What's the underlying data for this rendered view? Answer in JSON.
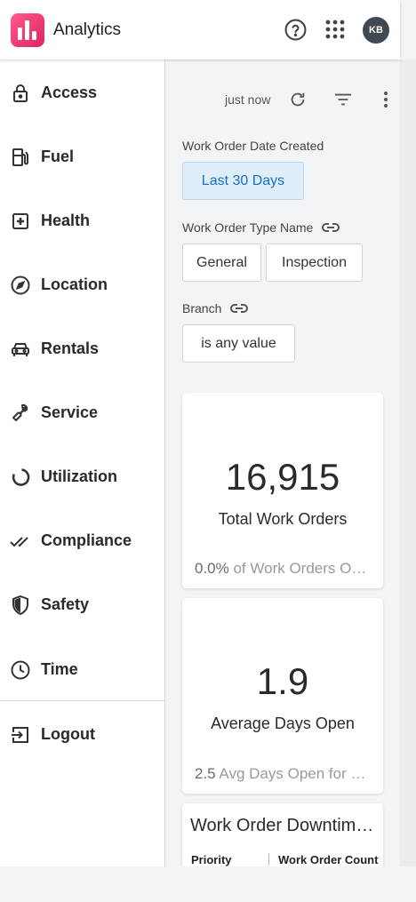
{
  "header": {
    "app_title": "Analytics",
    "help_icon": "help-circle-icon",
    "apps_icon": "apps-grid-icon",
    "avatar_initials": "KB"
  },
  "sidebar": {
    "items": [
      {
        "label": "Access",
        "icon": "lock-icon"
      },
      {
        "label": "Fuel",
        "icon": "fuel-pump-icon"
      },
      {
        "label": "Health",
        "icon": "medical-plus-icon"
      },
      {
        "label": "Location",
        "icon": "compass-icon"
      },
      {
        "label": "Rentals",
        "icon": "car-icon"
      },
      {
        "label": "Service",
        "icon": "wrench-icon"
      },
      {
        "label": "Utilization",
        "icon": "donut-icon"
      },
      {
        "label": "Compliance",
        "icon": "double-check-icon"
      },
      {
        "label": "Safety",
        "icon": "shield-icon"
      },
      {
        "label": "Time",
        "icon": "clock-icon"
      }
    ],
    "logout": {
      "label": "Logout",
      "icon": "logout-icon"
    }
  },
  "toolbar": {
    "updated_text": "just now",
    "refresh_icon": "refresh-icon",
    "filter_icon": "filter-icon",
    "more_icon": "more-vertical-icon"
  },
  "filters": {
    "date": {
      "label": "Work Order Date Created",
      "value": "Last 30 Days"
    },
    "type": {
      "label": "Work Order Type Name",
      "options": [
        "General",
        "Inspection"
      ]
    },
    "branch": {
      "label": "Branch",
      "value": "is any value"
    }
  },
  "tiles": {
    "total": {
      "value": "16,915",
      "label": "Total Work Orders",
      "foot_value": "0.0%",
      "foot_text": " of Work Orders Overdue"
    },
    "avg": {
      "value": "1.9",
      "label": "Average Days Open",
      "foot_value": "2.5",
      "foot_text": " Avg Days Open for Overdue"
    },
    "downtime": {
      "title": "Work Order Downtime by Priority",
      "col1": "Priority",
      "col2": "Work Order Count"
    }
  },
  "colors": {
    "accent": "#1a6ec7",
    "brand": "#e0245e",
    "active_chip_bg": "#dfeefb"
  }
}
